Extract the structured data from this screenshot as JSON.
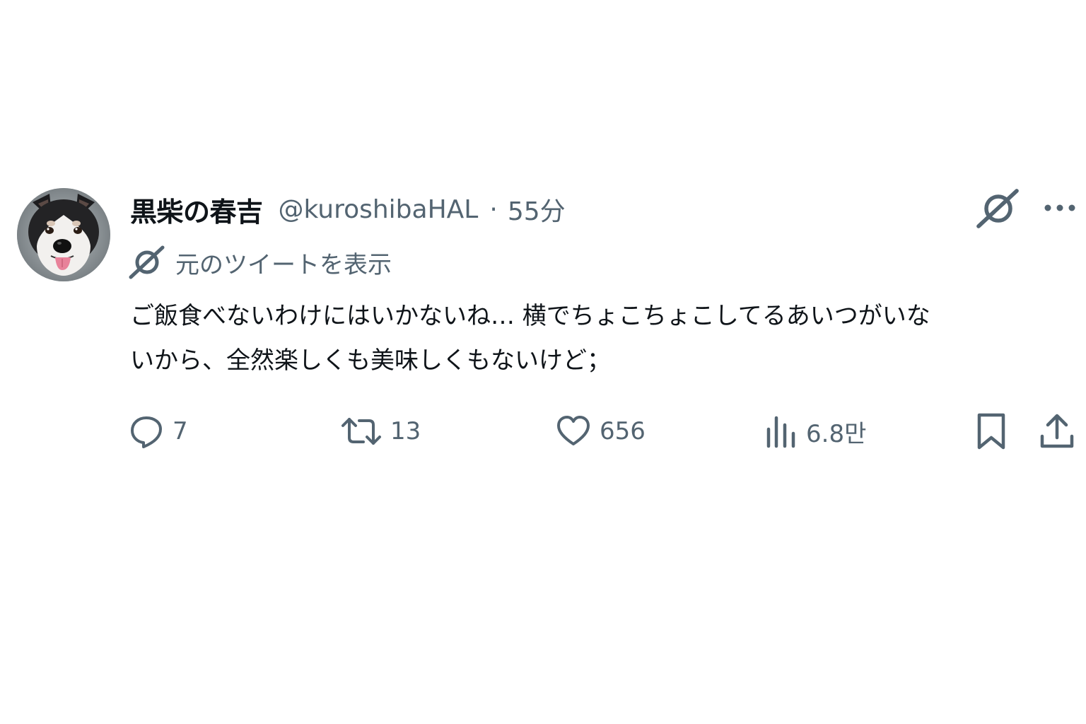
{
  "tweet": {
    "display_name": "黒柴の春吉",
    "handle": "@kuroshibaHAL",
    "separator": "·",
    "time": "55分",
    "original_link": "元のツイートを表示",
    "text": "ご飯食べないわけにはいかないね… 横でちょこちょこしてるあいつがいな\nいから、全然楽しくも美味しくもないけど；",
    "avatar": "shiba-dog-photo"
  },
  "actions": {
    "replies": "7",
    "retweets": "13",
    "likes": "656",
    "views": "6.8만"
  },
  "icons": {
    "grok": "grok-icon",
    "more": "more-dots-icon",
    "reply": "reply-icon",
    "retweet": "retweet-icon",
    "like": "heart-icon",
    "views": "views-chart-icon",
    "bookmark": "bookmark-icon",
    "share": "share-icon"
  },
  "colors": {
    "text": "#0f1419",
    "secondary": "#536471",
    "background": "#ffffff"
  }
}
